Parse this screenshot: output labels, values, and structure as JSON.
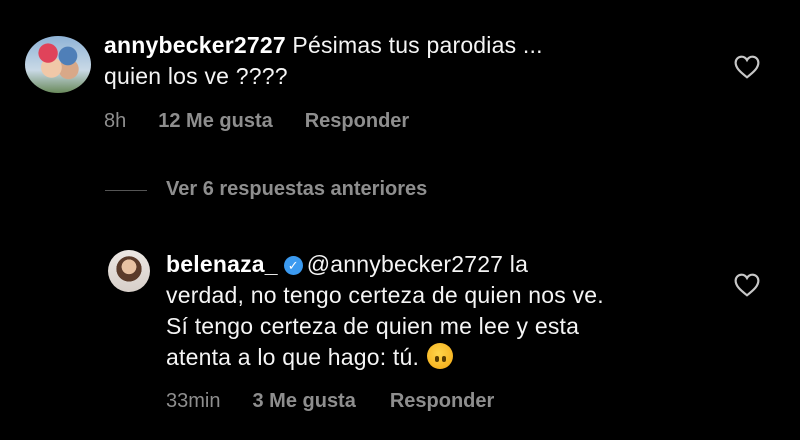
{
  "comments": [
    {
      "username": "annybecker2727",
      "text_line1": "Pésimas tus parodias ...",
      "text_line2": "quien los ve ????",
      "time": "8h",
      "likes": "12 Me gusta",
      "reply": "Responder"
    },
    {
      "username": "belenaza_",
      "mention": "@annybecker2727",
      "text_line1_rest": "la",
      "text_line2": "verdad, no tengo certeza de quien nos ve.",
      "text_line3": "Sí tengo certeza de quien me lee y esta",
      "text_line4": "atenta a lo que hago: tú.",
      "time": "33min",
      "likes": "3 Me gusta",
      "reply": "Responder"
    }
  ],
  "view_replies_label": "Ver 6 respuestas anteriores",
  "icons": {
    "like": "heart-outline-icon",
    "verified": "verified-badge-icon",
    "emoji": "upside-down-face-emoji"
  },
  "colors": {
    "background": "#000000",
    "text": "#f5f5f5",
    "muted": "#8e8e8e",
    "verified": "#3b9af0"
  }
}
